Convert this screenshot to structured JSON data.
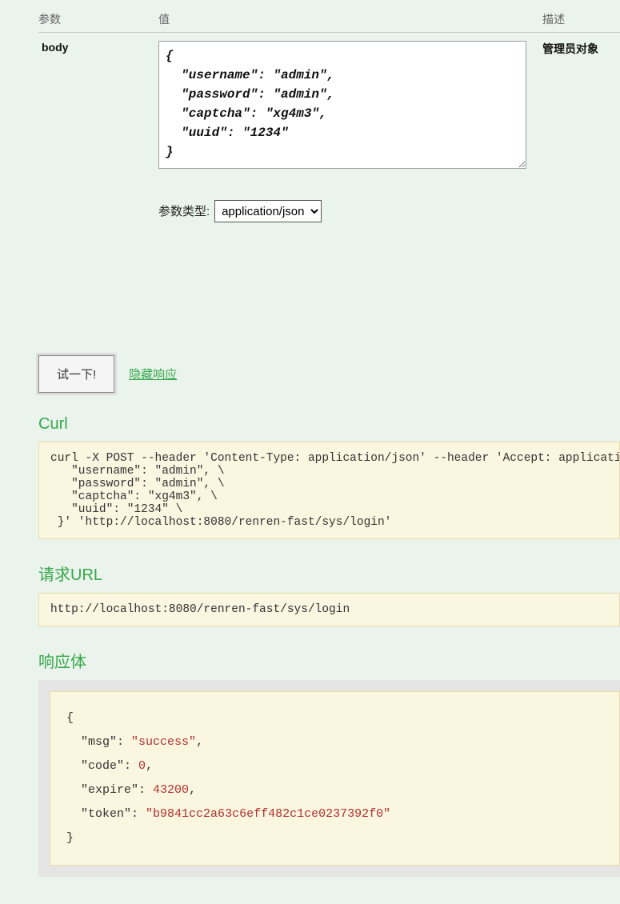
{
  "headers": {
    "param": "参数",
    "value": "值",
    "desc": "描述"
  },
  "param_row": {
    "name": "body",
    "body_value": "{\n  \"username\": \"admin\",\n  \"password\": \"admin\",\n  \"captcha\": \"xg4m3\",\n  \"uuid\": \"1234\"\n}",
    "type_label": "参数类型:",
    "type_value": "application/json",
    "desc": "管理员对象"
  },
  "actions": {
    "try_it": "试一下!",
    "hide_response": "隐藏响应"
  },
  "sections": {
    "curl_heading": "Curl",
    "curl_body": "curl -X POST --header 'Content-Type: application/json' --header 'Accept: application/json' -d '{ \\\n   \"username\": \"admin\", \\\n   \"password\": \"admin\", \\\n   \"captcha\": \"xg4m3\", \\\n   \"uuid\": \"1234\" \\\n }' 'http://localhost:8080/renren-fast/sys/login'",
    "url_heading": "请求URL",
    "url_body": "http://localhost:8080/renren-fast/sys/login",
    "resp_heading": "响应体",
    "resp_json": {
      "msg": "success",
      "code": 0,
      "expire": 43200,
      "token": "b9841cc2a63c6eff482c1ce0237392f0"
    }
  }
}
